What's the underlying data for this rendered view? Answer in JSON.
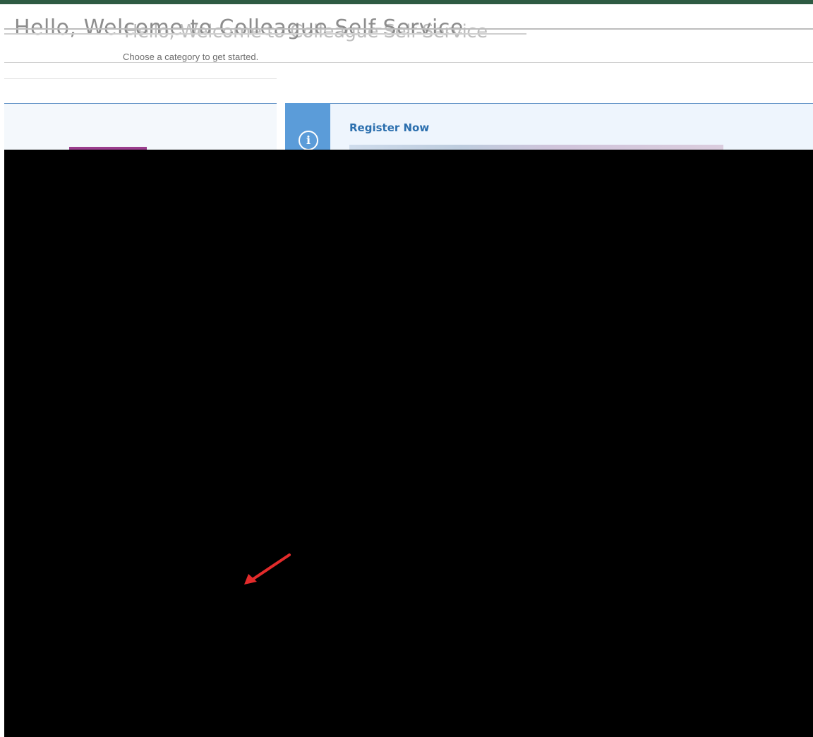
{
  "header": {
    "title": "Hello, Welcome to Colleague Self-Service",
    "subtitle": "Choose a category to get started."
  },
  "notice": {
    "title": "Register Now",
    "icon": "info-icon"
  },
  "annotation": {
    "icon": "arrow-icon",
    "color": "#e32b2b"
  },
  "colors": {
    "brand_bar": "#2e5b43",
    "accent": "#5b9cd9",
    "link": "#2b6fae"
  }
}
